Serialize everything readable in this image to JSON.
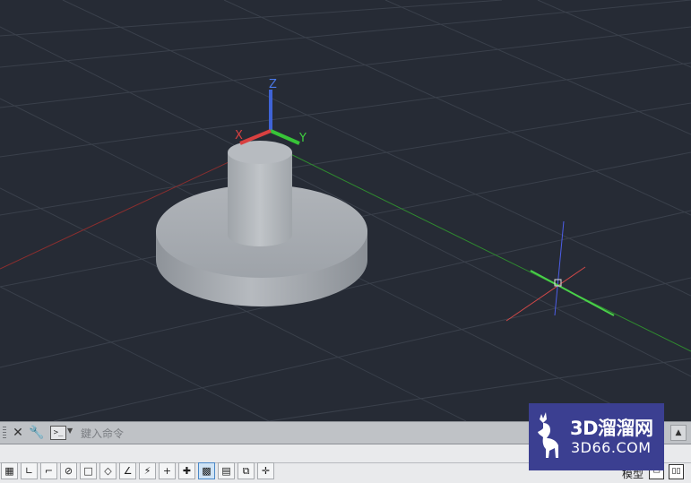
{
  "viewport": {
    "axis_labels": {
      "z": "Z",
      "y": "Y",
      "x": "X"
    },
    "colors": {
      "background": "#262b35",
      "grid": "#3b414c",
      "x_axis": "#c43a3a",
      "y_axis": "#3fbf3f",
      "z_axis": "#4169e1",
      "solid": "#a9adb2"
    }
  },
  "command_line": {
    "close_icon": "close-icon",
    "customize_icon": "wrench-icon",
    "prompt_icon": "command-prompt-icon",
    "input_placeholder": "鍵入命令",
    "input_value": ""
  },
  "status_bar": {
    "model_label": "模型",
    "tools": [
      "grid-icon",
      "snap-icon",
      "ortho-icon",
      "polar-icon",
      "osnap-icon",
      "3d-osnap-icon",
      "otrack-icon",
      "ducs-icon",
      "dyn-icon",
      "lineweight-icon",
      "transparency-icon",
      "qp-icon",
      "sc-icon",
      "am-icon"
    ]
  },
  "watermark": {
    "line1": "3D溜溜网",
    "line2": "3D66.COM"
  }
}
